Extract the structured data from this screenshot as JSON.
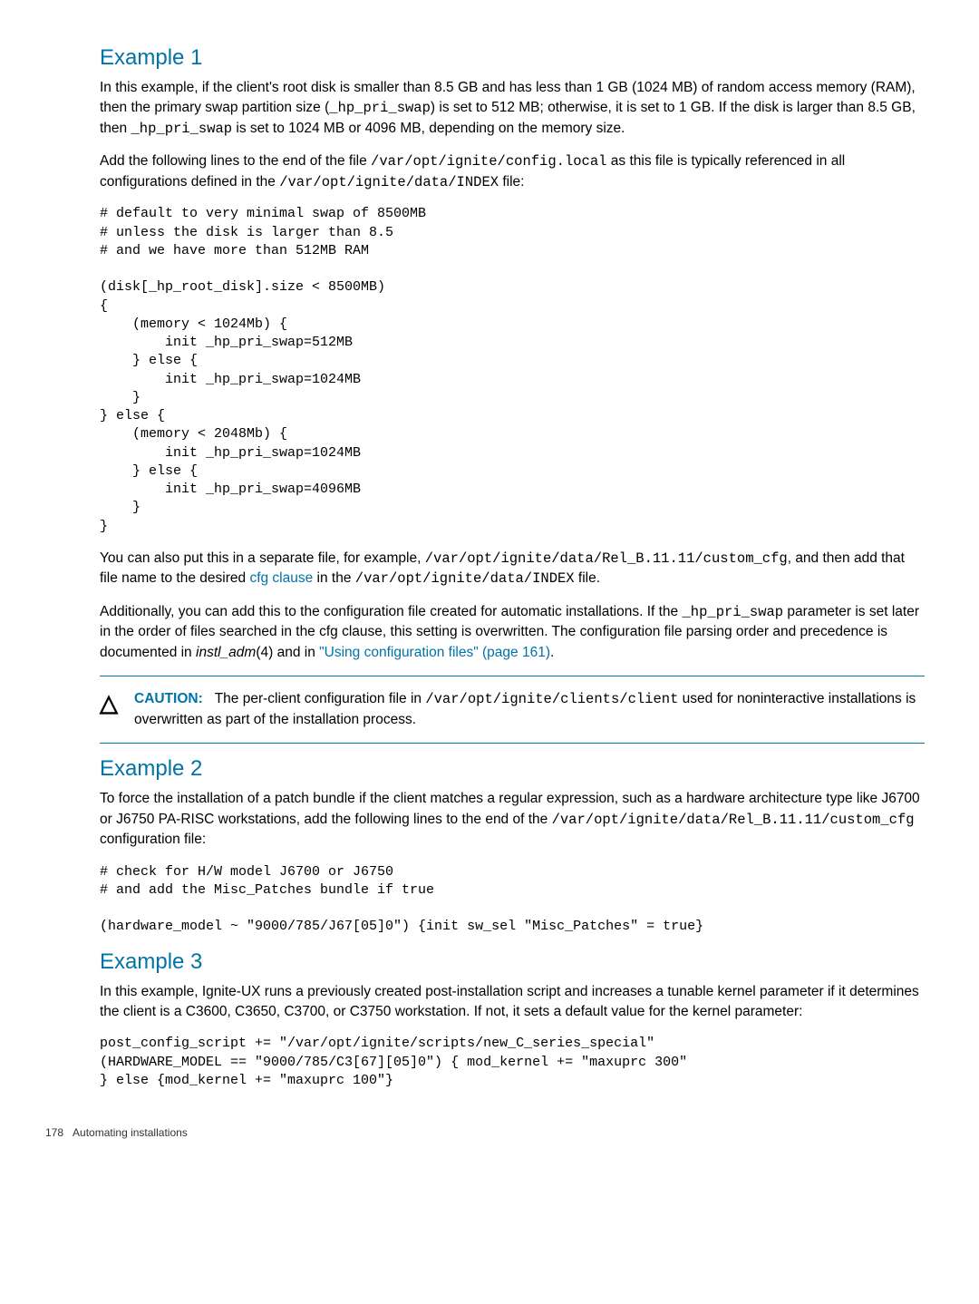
{
  "ex1": {
    "heading": "Example 1",
    "p1_a": "In this example, if the client's root disk is smaller than 8.5 GB and has less than 1 GB (1024 MB) of random access memory (RAM), then the primary swap partition size (",
    "p1_code1": "_hp_pri_swap",
    "p1_b": ") is set to 512 MB; otherwise, it is set to 1 GB. If the disk is larger than 8.5 GB, then ",
    "p1_code2": "_hp_pri_swap",
    "p1_c": " is set to 1024 MB or 4096 MB, depending on the memory size.",
    "p2_a": "Add the following lines to the end of the file ",
    "p2_code1": "/var/opt/ignite/config.local",
    "p2_b": " as this file is typically referenced in all configurations defined in the ",
    "p2_code2": "/var/opt/ignite/data/INDEX",
    "p2_c": " file:",
    "codeblock": "# default to very minimal swap of 8500MB\n# unless the disk is larger than 8.5\n# and we have more than 512MB RAM\n\n(disk[_hp_root_disk].size < 8500MB)\n{\n    (memory < 1024Mb) {\n        init _hp_pri_swap=512MB\n    } else {\n        init _hp_pri_swap=1024MB\n    }\n} else {\n    (memory < 2048Mb) {\n        init _hp_pri_swap=1024MB\n    } else {\n        init _hp_pri_swap=4096MB\n    }\n}",
    "p3_a": "You can also put this in a separate file, for example, ",
    "p3_code1": "/var/opt/ignite/data/Rel_B.11.11/custom_cfg",
    "p3_b": ", and then add that file name to the desired ",
    "p3_link": "cfg clause",
    "p3_c": " in the ",
    "p3_code2": "/var/opt/ignite/data/INDEX",
    "p3_d": " file.",
    "p4_a": "Additionally, you can add this to the configuration file created for automatic installations. If the ",
    "p4_code1": "_hp_pri_swap",
    "p4_b": " parameter is set later in the order of files searched in the cfg clause, this setting is overwritten. The configuration file parsing order and precedence is documented in ",
    "p4_italic": "instl_adm",
    "p4_c": "(4) and in ",
    "p4_link": "\"Using configuration files\" (page 161)",
    "p4_d": "."
  },
  "caution": {
    "label": "CAUTION:",
    "text_a": "The per-client configuration file in ",
    "code": "/var/opt/ignite/clients/client",
    "text_b": " used for noninteractive installations is overwritten as part of the installation process."
  },
  "ex2": {
    "heading": "Example 2",
    "p1_a": "To force the installation of a patch bundle if the client matches a regular expression, such as a hardware architecture type like J6700 or J6750 PA-RISC workstations, add the following lines to the end of the ",
    "p1_code": "/var/opt/ignite/data/Rel_B.11.11/custom_cfg",
    "p1_b": " configuration file:",
    "codeblock": "# check for H/W model J6700 or J6750\n# and add the Misc_Patches bundle if true\n\n(hardware_model ~ \"9000/785/J67[05]0\") {init sw_sel \"Misc_Patches\" = true}"
  },
  "ex3": {
    "heading": "Example 3",
    "p1": "In this example, Ignite-UX runs a previously created post-installation script and increases a tunable kernel parameter if it determines the client is a C3600, C3650, C3700, or C3750 workstation. If not, it sets a default value for the kernel parameter:",
    "codeblock": "post_config_script += \"/var/opt/ignite/scripts/new_C_series_special\"\n(HARDWARE_MODEL == \"9000/785/C3[67][05]0\") { mod_kernel += \"maxuprc 300\"\n} else {mod_kernel += \"maxuprc 100\"}"
  },
  "footer": {
    "page": "178",
    "section": "Automating installations"
  }
}
